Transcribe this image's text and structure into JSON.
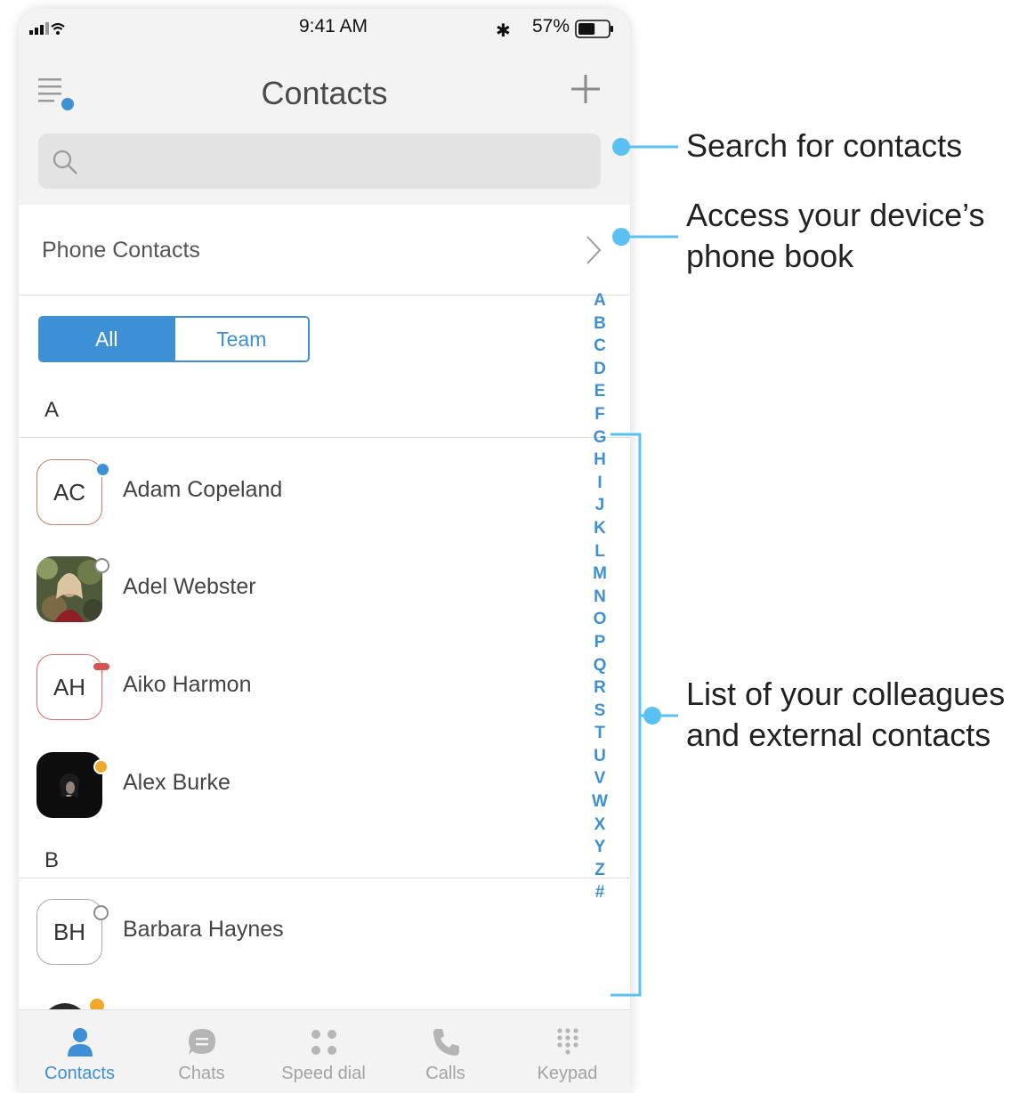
{
  "status_bar": {
    "time": "9:41 AM",
    "battery_percent": "57%",
    "battery_level": 0.57,
    "icons": [
      "signal-icon",
      "wifi-icon",
      "bluetooth-icon",
      "battery-icon"
    ]
  },
  "header": {
    "title": "Contacts",
    "menu_icon": "menu-icon",
    "add_icon": "plus-icon"
  },
  "search": {
    "placeholder": "",
    "icon": "search-icon"
  },
  "phone_contacts": {
    "label": "Phone Contacts",
    "icon": "chevron-right-icon"
  },
  "filter": {
    "options": [
      "All",
      "Team"
    ],
    "selected": "All"
  },
  "sections": [
    {
      "letter": "A",
      "contacts": [
        {
          "initials": "AC",
          "name": "Adam Copeland",
          "avatar_type": "initials",
          "status": "available"
        },
        {
          "initials": "",
          "name": "Adel Webster",
          "avatar_type": "photo",
          "status": "offline"
        },
        {
          "initials": "AH",
          "name": "Aiko Harmon",
          "avatar_type": "initials",
          "status": "busy"
        },
        {
          "initials": "",
          "name": "Alex Burke",
          "avatar_type": "photo",
          "status": "away"
        }
      ]
    },
    {
      "letter": "B",
      "contacts": [
        {
          "initials": "BH",
          "name": "Barbara Haynes",
          "avatar_type": "initials",
          "status": "offline"
        }
      ]
    }
  ],
  "alphabet_index": [
    "A",
    "B",
    "C",
    "D",
    "E",
    "F",
    "G",
    "H",
    "I",
    "J",
    "K",
    "L",
    "M",
    "N",
    "O",
    "P",
    "Q",
    "R",
    "S",
    "T",
    "U",
    "V",
    "W",
    "X",
    "Y",
    "Z",
    "#"
  ],
  "tabs": [
    {
      "label": "Contacts",
      "icon": "person-icon",
      "active": true
    },
    {
      "label": "Chats",
      "icon": "chat-bubble-icon",
      "active": false
    },
    {
      "label": "Speed dial",
      "icon": "speed-dial-icon",
      "active": false
    },
    {
      "label": "Calls",
      "icon": "phone-icon",
      "active": false
    },
    {
      "label": "Keypad",
      "icon": "keypad-icon",
      "active": false
    }
  ],
  "annotations": {
    "search": "Search for contacts",
    "phonebook_line1": "Access your device’s",
    "phonebook_line2": "phone book",
    "list_line1": "List of your colleagues",
    "list_line2": "and external contacts"
  },
  "colors": {
    "accent": "#3d8fd6",
    "callout": "#5bc0f2",
    "status_available": "#3d8fd6",
    "status_busy": "#d9534f",
    "status_away": "#f0a92b",
    "avatar_border_busy": "#e06a6a",
    "avatar_border_ac": "#c9805d"
  }
}
